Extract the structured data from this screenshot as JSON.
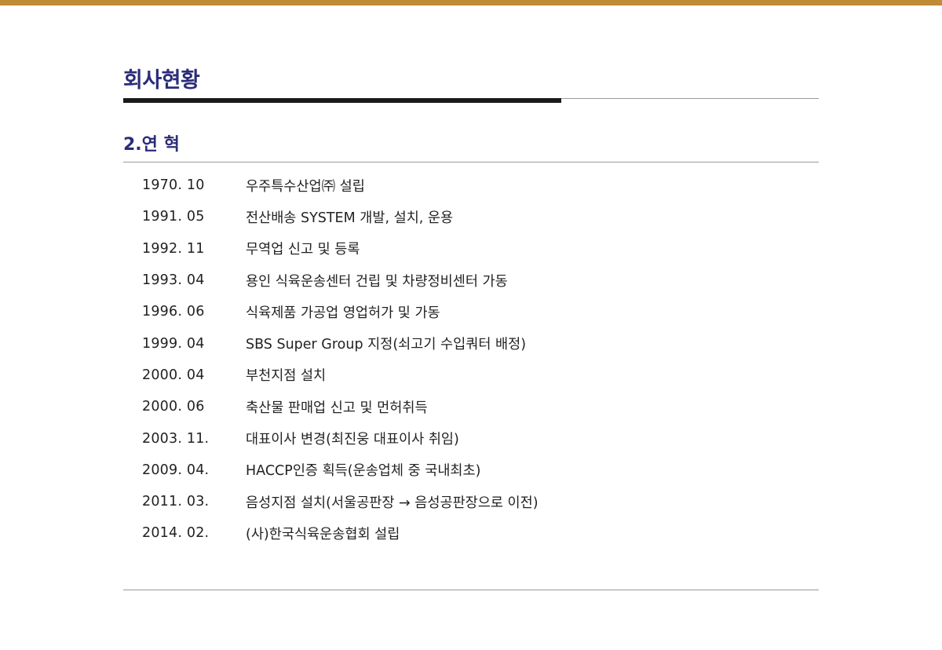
{
  "header": {
    "title": "회사현황",
    "accent_color": "#c08a36",
    "title_color": "#2b2d78"
  },
  "section": {
    "title": "2.연 혁"
  },
  "history": [
    {
      "date": "1970. 10",
      "event": "우주특수산업㈜ 설립"
    },
    {
      "date": "1991. 05",
      "event": "전산배송 SYSTEM 개발, 설치, 운용"
    },
    {
      "date": "1992. 11",
      "event": "무역업 신고 및 등록"
    },
    {
      "date": "1993. 04",
      "event": "용인 식육운송센터 건립 및 차량정비센터 가동"
    },
    {
      "date": "1996. 06",
      "event": "식육제품 가공업 영업허가 및 가동"
    },
    {
      "date": "1999. 04",
      "event": "SBS Super Group 지정(쇠고기 수입쿼터 배정)"
    },
    {
      "date": "2000. 04",
      "event": "부천지점 설치"
    },
    {
      "date": "2000. 06",
      "event": "축산물 판매업 신고 및 먼허취득"
    },
    {
      "date": "2003. 11.",
      "event": "대표이사 변경(최진웅 대표이사 취임)"
    },
    {
      "date": "2009. 04.",
      "event": "HACCP인증 획득(운송업체 중 국내최초)"
    },
    {
      "date": "2011. 03.",
      "event": "음성지점 설치(서울공판장 → 음성공판장으로 이전)"
    },
    {
      "date": "2014. 02.",
      "event": "(사)한국식육운송협회 설립"
    }
  ]
}
